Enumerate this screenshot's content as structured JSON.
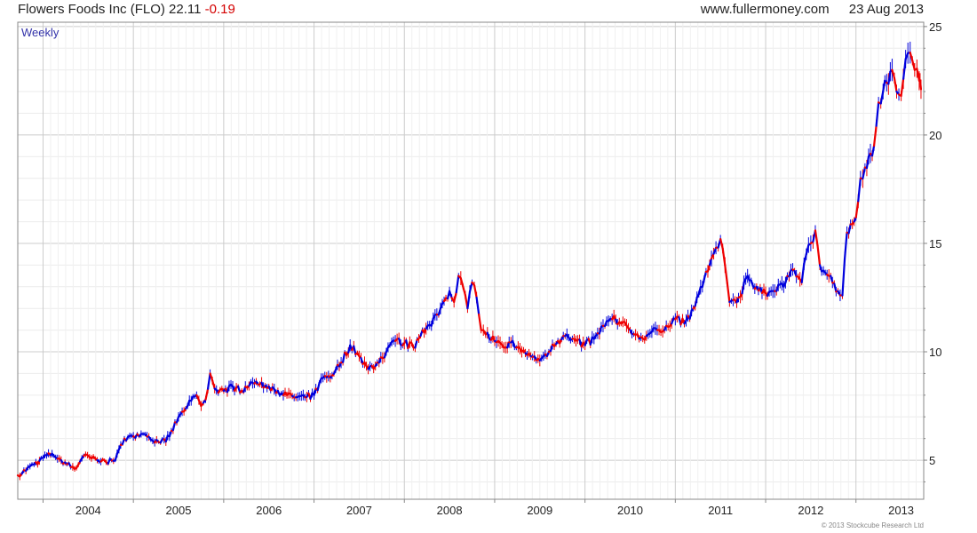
{
  "header": {
    "company": "Flowers Foods Inc (FLO)",
    "price": "22.11",
    "change": "-0.19",
    "website": "www.fullermoney.com",
    "date": "23 Aug 2013"
  },
  "footer": {
    "copyright": "© 2013 Stockcube Research Ltd"
  },
  "colors": {
    "up": "#0000dd",
    "down": "#ee0000",
    "grid": "#cccccc",
    "axis": "#888888",
    "label": "#3333aa"
  },
  "chart_data": {
    "type": "line",
    "period_label": "Weekly",
    "x_start": 2003.72,
    "x_end": 2013.75,
    "ylim": [
      3.2,
      25.2
    ],
    "yticks": [
      5,
      10,
      15,
      20,
      25
    ],
    "xticks": [
      "2004",
      "2005",
      "2006",
      "2007",
      "2008",
      "2009",
      "2010",
      "2011",
      "2012",
      "2013"
    ],
    "series": [
      {
        "points": [
          [
            2003.72,
            4.3
          ],
          [
            2003.9,
            4.8
          ],
          [
            2004.0,
            5.1
          ],
          [
            2004.1,
            5.3
          ],
          [
            2004.2,
            5.0
          ],
          [
            2004.35,
            4.6
          ],
          [
            2004.45,
            5.2
          ],
          [
            2004.6,
            5.0
          ],
          [
            2004.7,
            4.9
          ],
          [
            2004.8,
            5.0
          ],
          [
            2004.9,
            6.0
          ],
          [
            2005.0,
            6.1
          ],
          [
            2005.15,
            6.1
          ],
          [
            2005.3,
            5.8
          ],
          [
            2005.4,
            6.1
          ],
          [
            2005.5,
            7.0
          ],
          [
            2005.6,
            7.5
          ],
          [
            2005.7,
            8.0
          ],
          [
            2005.75,
            7.5
          ],
          [
            2005.8,
            7.8
          ],
          [
            2005.85,
            9.0
          ],
          [
            2005.9,
            8.3
          ],
          [
            2006.0,
            8.2
          ],
          [
            2006.1,
            8.4
          ],
          [
            2006.2,
            8.2
          ],
          [
            2006.3,
            8.6
          ],
          [
            2006.4,
            8.5
          ],
          [
            2006.5,
            8.4
          ],
          [
            2006.6,
            8.2
          ],
          [
            2006.7,
            8.0
          ],
          [
            2006.8,
            7.9
          ],
          [
            2006.9,
            7.9
          ],
          [
            2007.0,
            8.0
          ],
          [
            2007.1,
            8.8
          ],
          [
            2007.2,
            8.9
          ],
          [
            2007.3,
            9.5
          ],
          [
            2007.4,
            10.3
          ],
          [
            2007.5,
            9.8
          ],
          [
            2007.6,
            9.2
          ],
          [
            2007.7,
            9.5
          ],
          [
            2007.8,
            10.0
          ],
          [
            2007.9,
            10.5
          ],
          [
            2008.0,
            10.4
          ],
          [
            2008.1,
            10.2
          ],
          [
            2008.2,
            11.0
          ],
          [
            2008.3,
            11.2
          ],
          [
            2008.4,
            12.0
          ],
          [
            2008.5,
            12.8
          ],
          [
            2008.55,
            12.3
          ],
          [
            2008.6,
            13.5
          ],
          [
            2008.65,
            13.0
          ],
          [
            2008.7,
            12.0
          ],
          [
            2008.75,
            13.2
          ],
          [
            2008.8,
            12.5
          ],
          [
            2008.85,
            11.0
          ],
          [
            2008.9,
            10.8
          ],
          [
            2009.0,
            10.5
          ],
          [
            2009.1,
            10.2
          ],
          [
            2009.2,
            10.5
          ],
          [
            2009.3,
            10.0
          ],
          [
            2009.4,
            9.8
          ],
          [
            2009.5,
            9.6
          ],
          [
            2009.6,
            10.0
          ],
          [
            2009.7,
            10.5
          ],
          [
            2009.8,
            10.8
          ],
          [
            2009.9,
            10.5
          ],
          [
            2010.0,
            10.3
          ],
          [
            2010.1,
            10.6
          ],
          [
            2010.2,
            11.2
          ],
          [
            2010.3,
            11.5
          ],
          [
            2010.4,
            11.3
          ],
          [
            2010.5,
            11.0
          ],
          [
            2010.6,
            10.6
          ],
          [
            2010.7,
            10.8
          ],
          [
            2010.8,
            11.0
          ],
          [
            2010.9,
            11.2
          ],
          [
            2011.0,
            11.5
          ],
          [
            2011.1,
            11.3
          ],
          [
            2011.2,
            12.0
          ],
          [
            2011.3,
            13.0
          ],
          [
            2011.4,
            14.3
          ],
          [
            2011.45,
            14.8
          ],
          [
            2011.5,
            15.2
          ],
          [
            2011.55,
            14.0
          ],
          [
            2011.6,
            12.3
          ],
          [
            2011.7,
            12.5
          ],
          [
            2011.8,
            13.5
          ],
          [
            2011.9,
            13.0
          ],
          [
            2012.0,
            12.7
          ],
          [
            2012.1,
            12.8
          ],
          [
            2012.2,
            13.0
          ],
          [
            2012.3,
            13.8
          ],
          [
            2012.4,
            13.2
          ],
          [
            2012.45,
            14.5
          ],
          [
            2012.5,
            15.0
          ],
          [
            2012.55,
            15.6
          ],
          [
            2012.6,
            14.0
          ],
          [
            2012.7,
            13.5
          ],
          [
            2012.8,
            12.8
          ],
          [
            2012.85,
            12.6
          ],
          [
            2012.9,
            15.5
          ],
          [
            2013.0,
            16.2
          ],
          [
            2013.05,
            18.0
          ],
          [
            2013.1,
            18.5
          ],
          [
            2013.2,
            19.5
          ],
          [
            2013.25,
            21.5
          ],
          [
            2013.3,
            22.0
          ],
          [
            2013.4,
            23.0
          ],
          [
            2013.45,
            22.0
          ],
          [
            2013.5,
            21.8
          ],
          [
            2013.55,
            23.5
          ],
          [
            2013.6,
            23.8
          ],
          [
            2013.65,
            23.0
          ],
          [
            2013.7,
            22.5
          ],
          [
            2013.72,
            22.11
          ]
        ]
      }
    ]
  }
}
